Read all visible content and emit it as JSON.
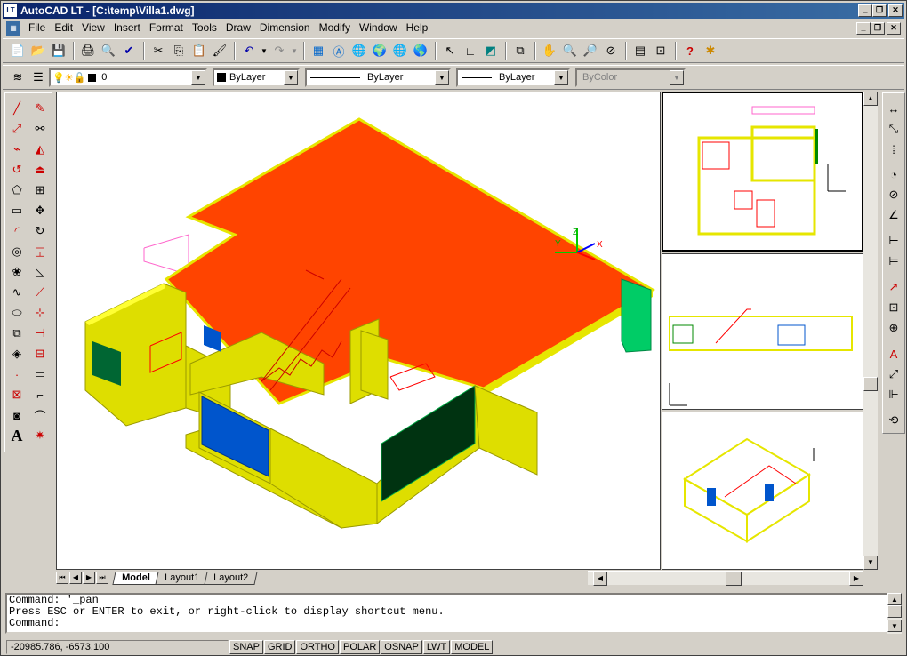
{
  "window": {
    "title": "AutoCAD LT - [C:\\temp\\Villa1.dwg]",
    "app_badge": "LT",
    "minimize_glyph": "_",
    "restore_glyph": "❐",
    "close_glyph": "✕"
  },
  "menu": [
    "File",
    "Edit",
    "View",
    "Insert",
    "Format",
    "Tools",
    "Draw",
    "Dimension",
    "Modify",
    "Window",
    "Help"
  ],
  "layer_bar": {
    "layer_value": "0",
    "color_value": "ByLayer",
    "linetype_value": "ByLayer",
    "lineweight_value": "ByLayer",
    "plotstyle_value": "ByColor"
  },
  "tabs": {
    "model": "Model",
    "layout1": "Layout1",
    "layout2": "Layout2"
  },
  "command": {
    "line1": "Command: '_pan",
    "line2": "Press ESC or ENTER to exit, or right-click to display shortcut menu.",
    "line3": "Command:"
  },
  "status": {
    "coords": "-20985.786, -6573.100",
    "buttons": [
      "SNAP",
      "GRID",
      "ORTHO",
      "POLAR",
      "OSNAP",
      "LWT",
      "MODEL"
    ]
  },
  "ucs": {
    "x": "X",
    "y": "Y",
    "z": "Z"
  },
  "colors": {
    "accent": "#0a246a",
    "floor": "#ff4400",
    "wall": "#e6e600",
    "green": "#00cc66"
  },
  "icons": {
    "new": "📄",
    "open": "📂",
    "save": "💾",
    "print": "🖨",
    "cut": "✂",
    "copy": "⎘",
    "paste": "📋",
    "undo": "↶",
    "redo": "↷",
    "help": "?"
  }
}
